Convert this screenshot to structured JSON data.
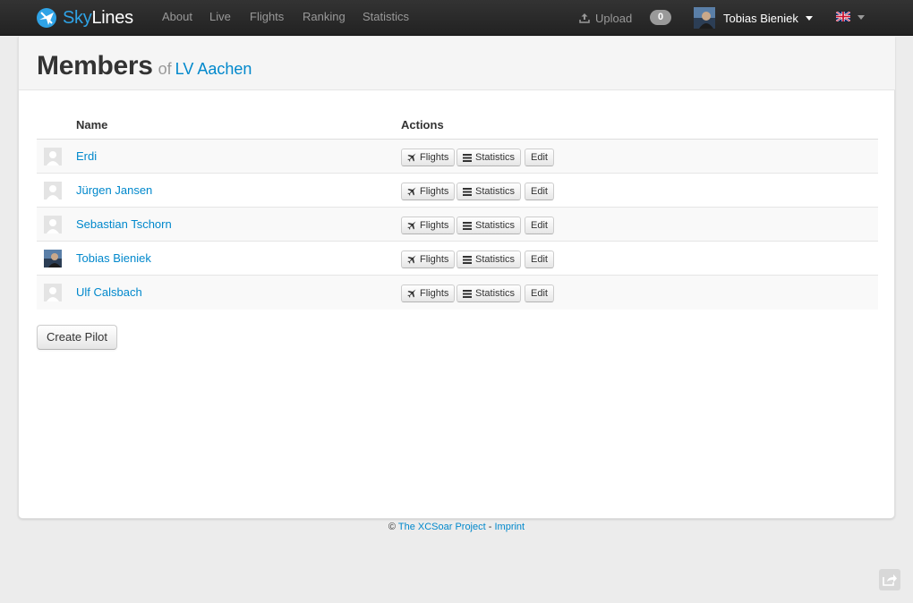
{
  "brand": {
    "part1": "Sky",
    "part2": "Lines"
  },
  "nav": {
    "about": "About",
    "live": "Live",
    "flights": "Flights",
    "ranking": "Ranking",
    "statistics": "Statistics"
  },
  "upload": {
    "label": "Upload"
  },
  "notifications": {
    "count": "0"
  },
  "user": {
    "name": "Tobias Bieniek"
  },
  "page": {
    "title": "Members",
    "of": "of",
    "club": "LV Aachen"
  },
  "table": {
    "headers": {
      "name": "Name",
      "actions": "Actions"
    },
    "rows": [
      {
        "name": "Erdi",
        "avatar": "default"
      },
      {
        "name": "Jürgen Jansen",
        "avatar": "default"
      },
      {
        "name": "Sebastian Tschorn",
        "avatar": "default"
      },
      {
        "name": "Tobias Bieniek",
        "avatar": "photo"
      },
      {
        "name": "Ulf Calsbach",
        "avatar": "default"
      }
    ],
    "actions": {
      "flights": "Flights",
      "statistics": "Statistics",
      "edit": "Edit"
    }
  },
  "create_pilot": "Create Pilot",
  "footer": {
    "copyright": "©",
    "project": "The XCSoar Project",
    "separator": "-",
    "imprint": "Imprint"
  },
  "colors": {
    "link": "#0088cc",
    "brand_accent": "#2fa3e6",
    "navbar": "#222222"
  },
  "icons": {
    "logo": "skylines-logo-icon",
    "upload": "upload-icon",
    "flag": "uk-flag-icon",
    "plane": "plane-icon",
    "stats": "list-icon",
    "share": "share-icon"
  }
}
